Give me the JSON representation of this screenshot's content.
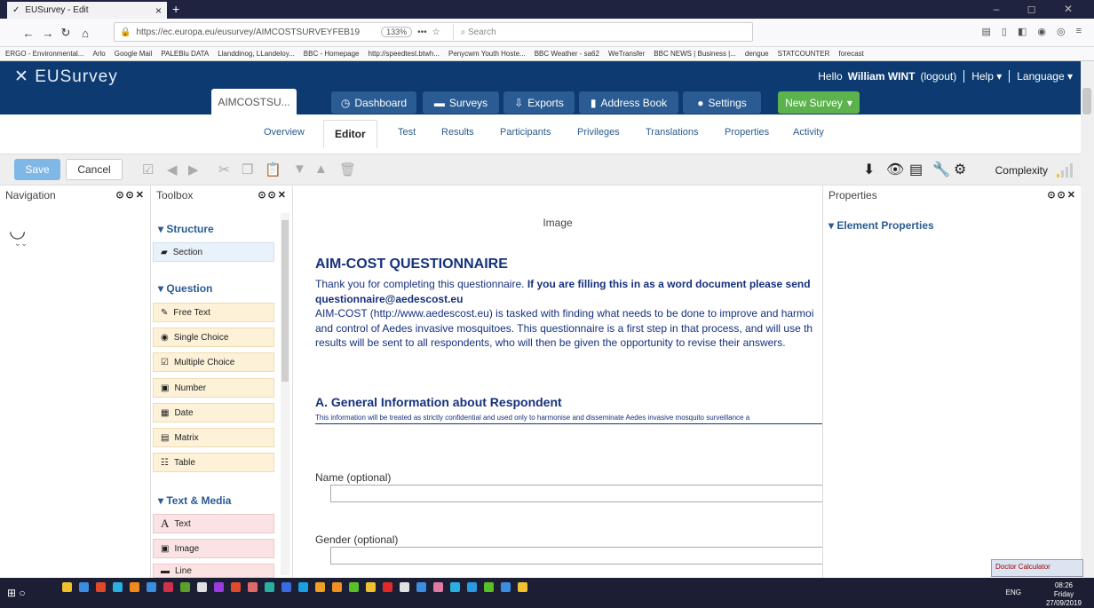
{
  "browser": {
    "tab_title": "EUSurvey - Edit",
    "url": "https://ec.europa.eu/eusurvey/AIMCOSTSURVEYFEB19",
    "zoom": "133%",
    "search_placeholder": "Search",
    "bookmarks": [
      "ERGO - Environmental...",
      "Arlo",
      "Google Mail",
      "PALEBlu DATA",
      "Llanddinog, LLandeloy...",
      "BBC - Homepage",
      "http://speedtest.btwh...",
      "Penycwm Youth Hoste...",
      "BBC Weather - sa62",
      "WeTransfer",
      "BBC NEWS | Business |...",
      "dengue",
      "STATCOUNTER",
      "forecast"
    ]
  },
  "header": {
    "logo": "EUSurvey",
    "hello": "Hello",
    "user": "William WINT",
    "logout": "(logout)",
    "help": "Help",
    "language": "Language",
    "survey_tab": "AIMCOSTSU...",
    "buttons": [
      "Dashboard",
      "Surveys",
      "Exports",
      "Address Book",
      "Settings"
    ],
    "new_survey": "New Survey"
  },
  "subnav": {
    "tabs": [
      "Overview",
      "Editor",
      "Test",
      "Results",
      "Participants",
      "Privileges",
      "Translations",
      "Properties",
      "Activity"
    ],
    "active": "Editor"
  },
  "toolbar": {
    "save": "Save",
    "cancel": "Cancel",
    "complexity": "Complexity"
  },
  "panels": {
    "navigation": "Navigation",
    "toolbox": "Toolbox",
    "properties": "Properties",
    "element_properties": "Element Properties"
  },
  "toolbox": {
    "structure": "Structure",
    "section": "Section",
    "question": "Question",
    "questions": [
      "Free Text",
      "Single Choice",
      "Multiple Choice",
      "Number",
      "Date",
      "Matrix",
      "Table"
    ],
    "text_media": "Text & Media",
    "media": [
      "Text",
      "Image",
      "Line"
    ]
  },
  "canvas": {
    "image_placeholder": "Image",
    "title": "AIM-COST QUESTIONNAIRE",
    "p1_start": "Thank you for completing this questionnaire.",
    "p1_bold": "If you are filling this in as a word document please send",
    "p1_email": "questionnaire@aedescost.eu",
    "p2": "AIM-COST (http://www.aedescost.eu) is tasked with finding what needs to be done to improve and harmoi",
    "p3": "and control of Aedes invasive mosquitoes. This questionnaire is a first step in that process, and will use th",
    "p4": "results will be sent to all respondents, who will then be given the opportunity to revise their answers.",
    "section_title": "A. General Information about Respondent",
    "section_note": "This information will be treated as strictly confidential and used only to harmonise and disseminate Aedes invasive mosquito surveillance a",
    "name_label": "Name (optional)",
    "gender_label": "Gender (optional)"
  },
  "taskbar": {
    "lang": "ENG",
    "time": "08:26",
    "day": "Friday",
    "date": "27/09/2019",
    "popup": "Doctor Calculator"
  }
}
